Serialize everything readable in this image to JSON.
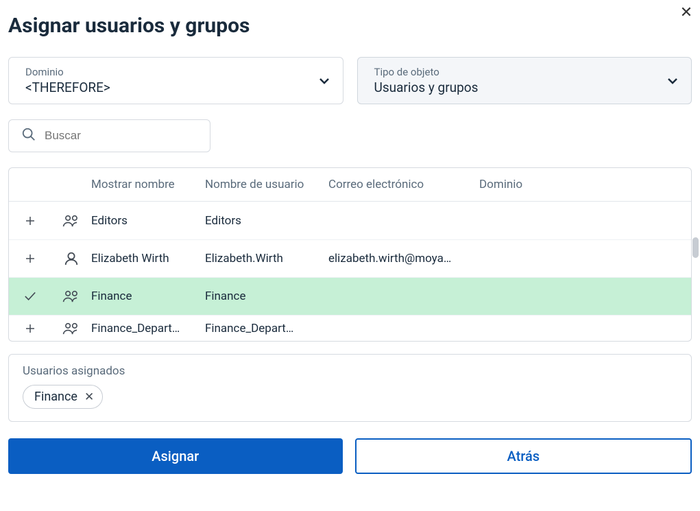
{
  "dialog": {
    "title": "Asignar usuarios y grupos"
  },
  "dropdowns": {
    "domain": {
      "label": "Dominio",
      "value": "<THEREFORE>"
    },
    "objectType": {
      "label": "Tipo de objeto",
      "value": "Usuarios y grupos"
    }
  },
  "search": {
    "placeholder": "Buscar"
  },
  "table": {
    "headers": {
      "displayName": "Mostrar nombre",
      "username": "Nombre de usuario",
      "email": "Correo electrónico",
      "domain": "Dominio"
    },
    "rows": [
      {
        "type": "group",
        "selected": false,
        "displayName": "Editors",
        "username": "Editors",
        "email": "",
        "domain": ""
      },
      {
        "type": "user",
        "selected": false,
        "displayName": "Elizabeth Wirth",
        "username": "Elizabeth.Wirth",
        "email": "elizabeth.wirth@moya…",
        "domain": ""
      },
      {
        "type": "group",
        "selected": true,
        "displayName": "Finance",
        "username": "Finance",
        "email": "",
        "domain": ""
      },
      {
        "type": "group",
        "selected": false,
        "displayName": "Finance_Depart…",
        "username": "Finance_Depart…",
        "email": "",
        "domain": ""
      }
    ]
  },
  "assigned": {
    "label": "Usuarios asignados",
    "chips": [
      {
        "label": "Finance"
      }
    ]
  },
  "buttons": {
    "assign": "Asignar",
    "back": "Atrás"
  }
}
